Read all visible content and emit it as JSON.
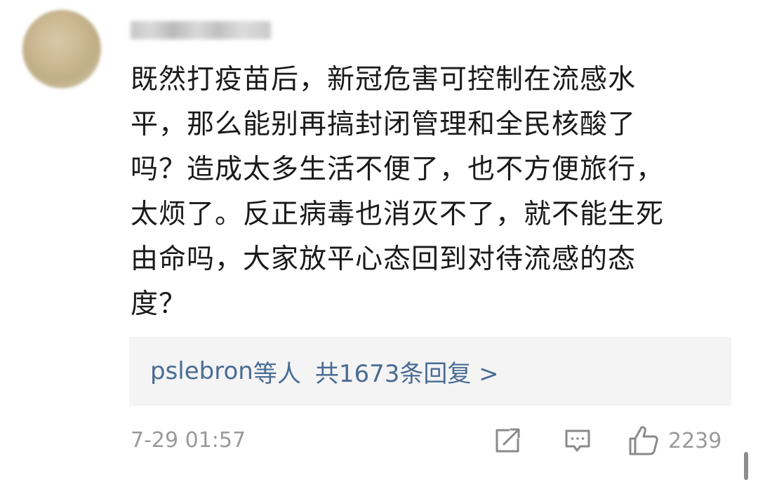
{
  "comment": {
    "lines": [
      "既然打疫苗后，新冠危害可控制在流感水",
      "平，那么能别再搞封闭管理和全民核酸了",
      "吗？造成太多生活不便了，也不方便旅行，",
      "太烦了。反正病毒也消灭不了，就不能生死",
      "由命吗，大家放平心态回到对待流感的态",
      "度？"
    ]
  },
  "replies": {
    "replier": "pslebron",
    "etal": "等人",
    "count_text": "共1673条回复 >"
  },
  "footer": {
    "timestamp": "7-29 01:57",
    "like_count": "2239"
  },
  "icons": {
    "avatar": "avatar-blurred",
    "share": "share-icon",
    "reply": "comment-icon",
    "like": "thumbs-up-icon"
  },
  "colors": {
    "link": "#4a6c94",
    "text": "#1a1a1a",
    "meta": "#9a9a9a",
    "reply_box_bg": "#f4f4f4"
  }
}
